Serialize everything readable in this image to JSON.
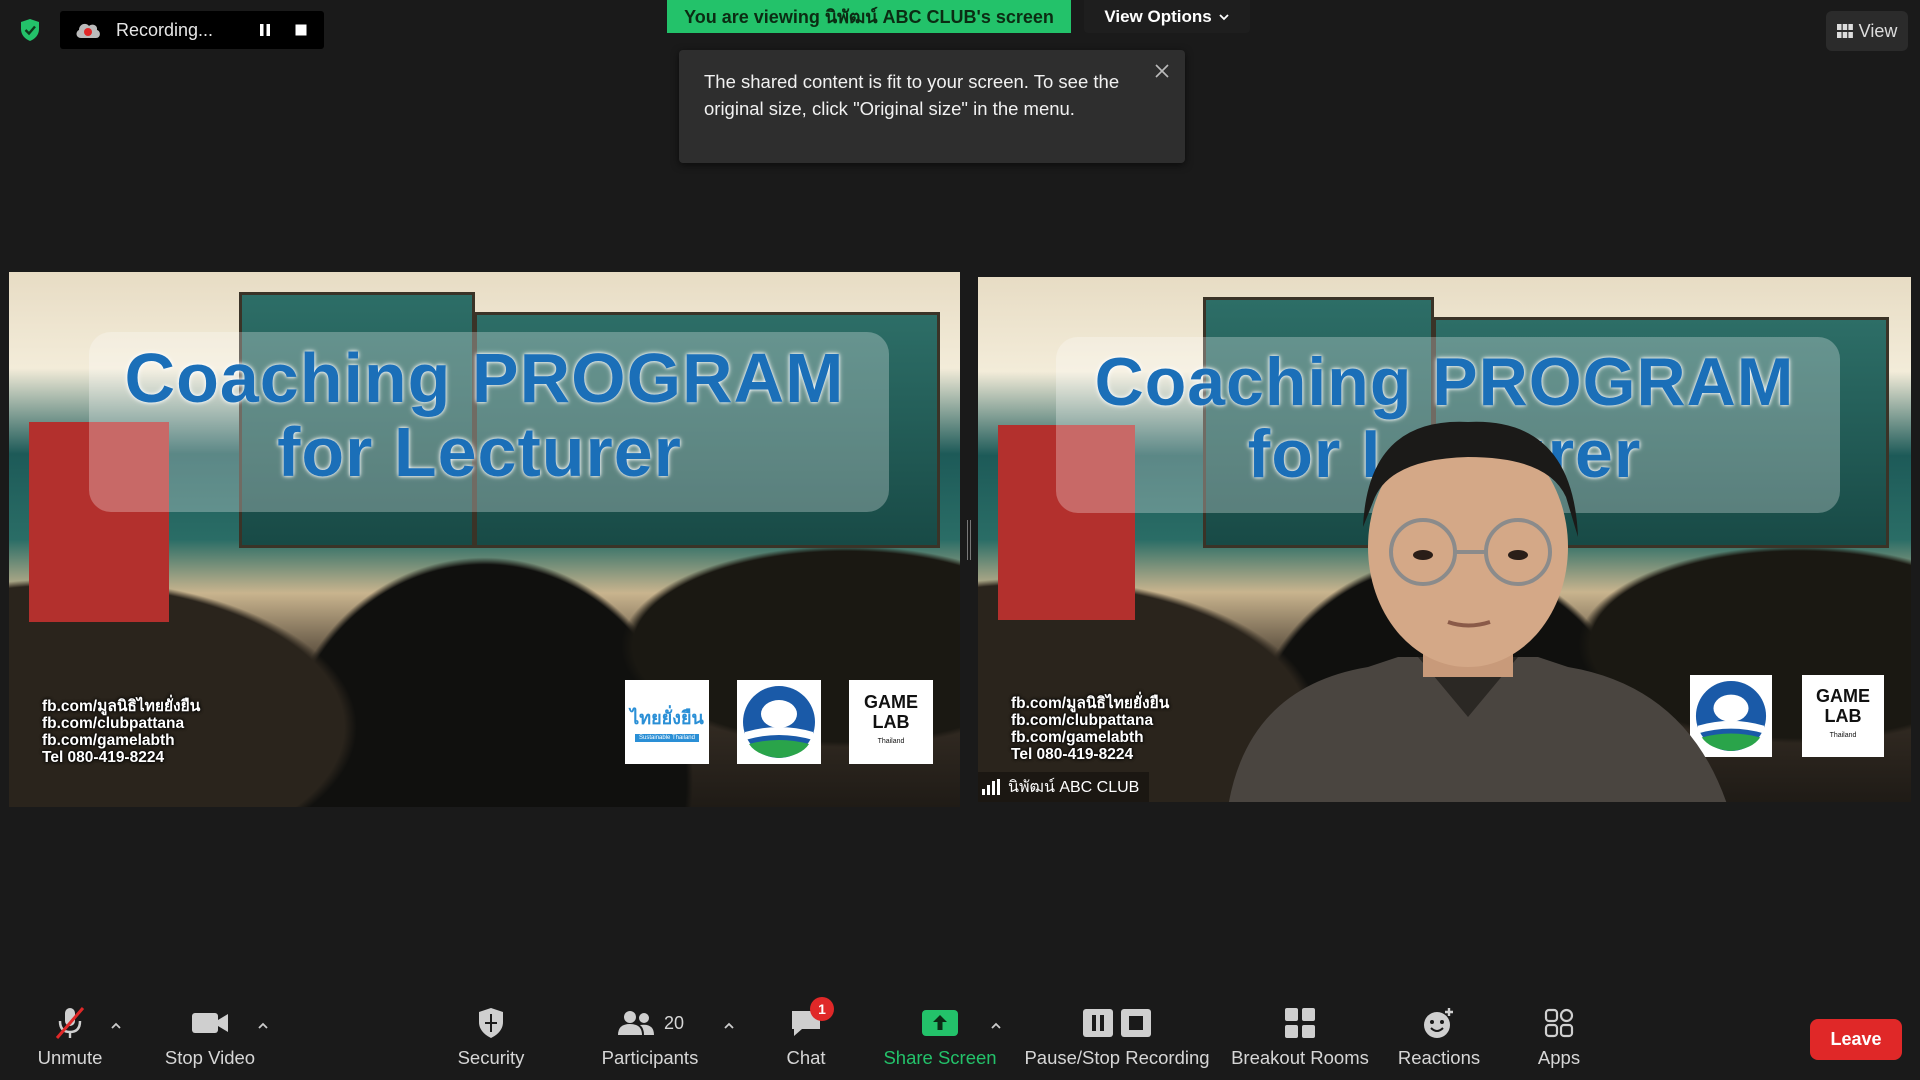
{
  "top_bar": {
    "recording_label": "Recording...",
    "viewing_banner": "You are viewing นิพัฒน์ ABC CLUB's screen",
    "view_options_label": "View Options",
    "view_label": "View"
  },
  "tooltip": {
    "message": "The shared content is fit to your screen. To see the original size, click \"Original size\" in the menu."
  },
  "slide": {
    "title_line1": "Coaching PROGRAM",
    "title_line2": "for Lecturer",
    "contacts": [
      "fb.com/มูลนิธิไทยยั่งยืน",
      "fb.com/clubpattana",
      "fb.com/gamelabth",
      "Tel 080-419-8224"
    ],
    "logo_thai": "ไทยยั่งยืน",
    "logo_thai_sub": "Sustainable Thailand",
    "logo_game": "GAME LAB",
    "logo_game_sub": "Thailand"
  },
  "video": {
    "participant_name": "นิพัฒน์ ABC CLUB"
  },
  "toolbar": {
    "unmute": "Unmute",
    "stop_video": "Stop Video",
    "security": "Security",
    "participants": "Participants",
    "participants_count": "20",
    "chat": "Chat",
    "chat_badge": "1",
    "share_screen": "Share Screen",
    "pause_stop_recording": "Pause/Stop Recording",
    "breakout_rooms": "Breakout Rooms",
    "reactions": "Reactions",
    "apps": "Apps",
    "leave": "Leave"
  },
  "colors": {
    "share_green": "#23c26a",
    "leave_red": "#e02828",
    "background": "#1a1a1a"
  }
}
